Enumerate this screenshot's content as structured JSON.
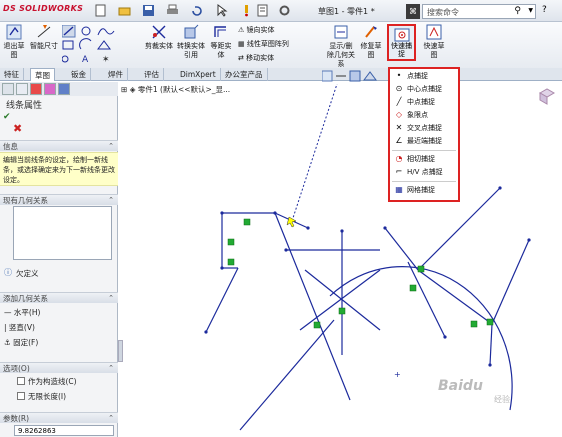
{
  "app": {
    "logo_brand": "DS",
    "logo_name": "SOLIDWORKS",
    "doc_title": "草图1 - 零件1 *"
  },
  "search": {
    "prefix": "⌘",
    "placeholder": "搜索命令",
    "help": "?"
  },
  "ribbon": {
    "big_buttons": [
      {
        "label": "退出草图"
      },
      {
        "label": "智能尺寸"
      },
      {
        "label": "剪裁实体"
      },
      {
        "label": "转换实体引用"
      },
      {
        "label": "等距实体"
      },
      {
        "label": "显示/删除几何关系"
      },
      {
        "label": "修复草图"
      },
      {
        "label": "快速捕捉"
      },
      {
        "label": "快速草图"
      }
    ],
    "small_items": [
      "镜向实体",
      "线性草图阵列",
      "移动实体"
    ]
  },
  "tabs": [
    "特征",
    "草图",
    "钣金",
    "焊件",
    "评估",
    "DimXpert",
    "办公室产品"
  ],
  "active_tab": "草图",
  "property_panel": {
    "title": "线条属性",
    "message_header": "信息",
    "message": "编辑当前线条的设定，绘制一新线条，或选择确定来为下一新线条更改设定。",
    "existing_relations_header": "现有几何关系",
    "status_text": "欠定义",
    "add_relations_header": "添加几何关系",
    "relations": [
      "水平(H)",
      "竖直(V)",
      "固定(F)"
    ],
    "options_header": "选项(O)",
    "options": [
      "作为构造线(C)",
      "无限长度(I)"
    ],
    "params_header": "参数(R)",
    "param_value": "9.8262863"
  },
  "tree": {
    "root": "零件1 (默认<<默认>_显..."
  },
  "snap_menu": {
    "items": [
      {
        "icon": "point-snap-icon",
        "glyph": "•",
        "label": "点捕捉"
      },
      {
        "icon": "center-point-snap-icon",
        "glyph": "⊙",
        "label": "中心点捕捉"
      },
      {
        "icon": "midpoint-snap-icon",
        "glyph": "╱",
        "label": "中点捕捉"
      },
      {
        "icon": "quadrant-point-icon",
        "glyph": "◇",
        "label": "象限点"
      },
      {
        "icon": "intersection-snap-icon",
        "glyph": "✕",
        "label": "交叉点捕捉"
      },
      {
        "icon": "nearest-snap-icon",
        "glyph": "∠",
        "label": "最近端捕捉"
      },
      {
        "icon": "tangent-snap-icon",
        "glyph": "◔",
        "label": "相切捕捉"
      },
      {
        "icon": "hv-point-snap-icon",
        "glyph": "⌐",
        "label": "H/V 点捕捉"
      },
      {
        "icon": "grid-snap-icon",
        "glyph": "▦",
        "label": "网格捕捉"
      }
    ]
  },
  "watermark": {
    "text": "Baidu",
    "sub": "经验"
  },
  "colors": {
    "sketch_line": "#1c2a9c",
    "relation_marker": "#22aa33",
    "highlight_border": "#dd2222",
    "message_bg": "#ffffc8"
  }
}
